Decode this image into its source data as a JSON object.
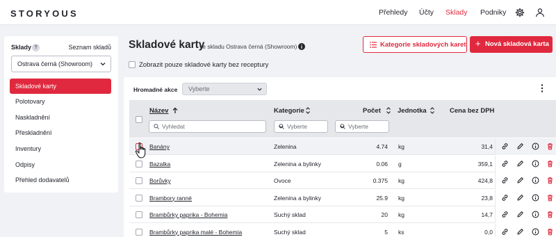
{
  "app": {
    "logo": "STORYOUS"
  },
  "nav": {
    "items": [
      "Přehledy",
      "Účty",
      "Sklady",
      "Podniky"
    ],
    "active": "Sklady",
    "icons": [
      "gear-icon",
      "user-icon"
    ]
  },
  "sidebar": {
    "title": "Sklady",
    "help": "?",
    "link": "Seznam skladů",
    "select_value": "Ostrava černá (Showroom)",
    "items": [
      "Skladové karty",
      "Polotovary",
      "Naskladnění",
      "Přeskladnění",
      "Inventury",
      "Odpisy",
      "Přehled dodavatelů"
    ],
    "active_index": 0
  },
  "header": {
    "title": "Skladové karty",
    "subtitle": "ve skladu Ostrava černá (Showroom)",
    "btn_categories": "Kategorie skladových karet",
    "btn_new": "Nová skladová karta",
    "filter_label": "Zobrazit pouze skladové karty bez receptury"
  },
  "table": {
    "bulk_label": "Hromadné akce",
    "bulk_placeholder": "Vyberte",
    "columns": {
      "name": "Název",
      "category": "Kategorie",
      "count": "Počet",
      "unit": "Jednotka",
      "price": "Cena bez DPH"
    },
    "name_search_placeholder": "Vyhledat",
    "category_filter_placeholder": "Vyberte",
    "unit_filter_placeholder": "Vyberte",
    "rows": [
      {
        "name": "Banány",
        "category": "Zelenina",
        "count": "4.74",
        "unit": "kg",
        "price": "31,4"
      },
      {
        "name": "Bazalka",
        "category": "Zelenina a bylinky",
        "count": "0.06",
        "unit": "g",
        "price": "359,1"
      },
      {
        "name": "Borůvky",
        "category": "Ovoce",
        "count": "0.375",
        "unit": "kg",
        "price": "424,8"
      },
      {
        "name": "Brambory ranné",
        "category": "Zelenina a bylinky",
        "count": "25.9",
        "unit": "kg",
        "price": "23,8"
      },
      {
        "name": "Brambůrky paprika - Bohemia",
        "category": "Suchý sklad",
        "count": "20",
        "unit": "kg",
        "price": "14,7"
      },
      {
        "name": "Brambůrky paprika malé - Bohemia",
        "category": "Suchý sklad",
        "count": "5",
        "unit": "ks",
        "price": "0,0"
      }
    ],
    "row_action_icons": [
      "link-icon",
      "pencil-icon",
      "info-icon",
      "trash-icon"
    ]
  },
  "colors": {
    "accent": "#e0293e",
    "background": "#f1f2f5",
    "header_row": "#e6e7eb"
  }
}
